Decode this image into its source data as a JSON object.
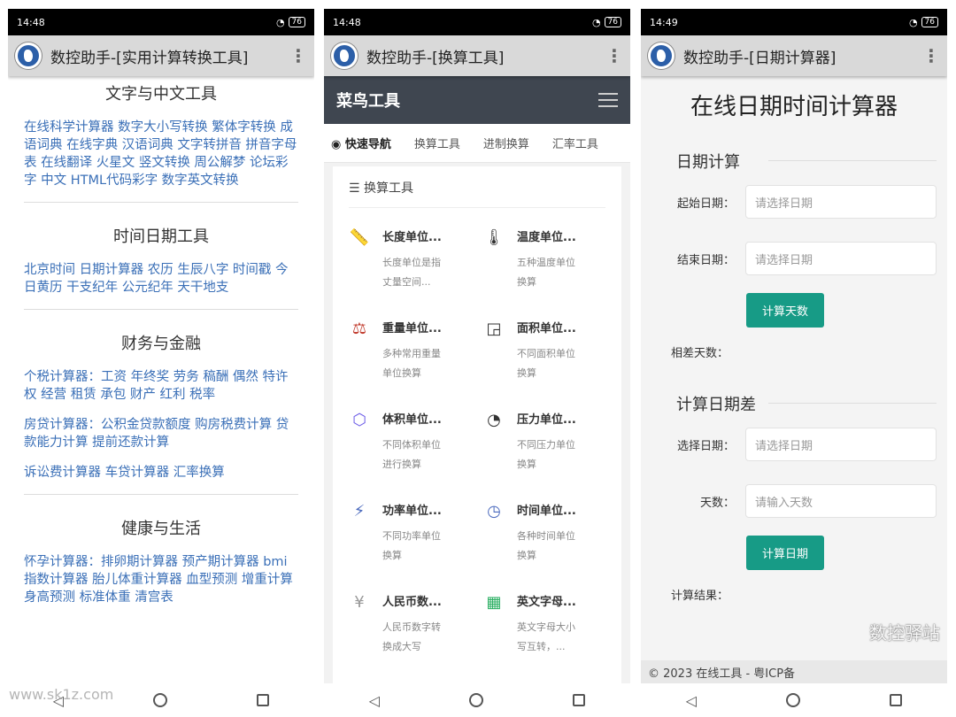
{
  "panel1": {
    "status_time": "14:48",
    "battery": "76",
    "app_title": "数控助手-[实用计算转换工具]",
    "sections": [
      {
        "title": "文字与中文工具",
        "paragraphs": [
          "在线科学计算器 数字大小写转换 繁体字转换 成语词典 在线字典 汉语词典 文字转拼音 拼音字母表 在线翻译 火星文 竖文转换 周公解梦 论坛彩字 中文 HTML代码彩字 数字英文转换"
        ]
      },
      {
        "title": "时间日期工具",
        "paragraphs": [
          "北京时间 日期计算器 农历 生辰八字 时间戳 今日黄历 干支纪年 公元纪年 天干地支"
        ]
      },
      {
        "title": "财务与金融",
        "paragraphs": [
          "个税计算器：工资 年终奖 劳务 稿酬 偶然 特许权 经营 租赁 承包 财产 红利 税率",
          "房贷计算器：公积金贷款额度 购房税费计算 贷款能力计算 提前还款计算",
          "诉讼费计算器 车贷计算器 汇率换算"
        ]
      },
      {
        "title": "健康与生活",
        "paragraphs": [
          "怀孕计算器：排卵期计算器 预产期计算器 bmi指数计算器 胎儿体重计算器 血型预测 增重计算 身高预测 标准体重 清宫表"
        ]
      }
    ]
  },
  "panel2": {
    "status_time": "14:48",
    "battery": "76",
    "app_title": "数控助手-[换算工具]",
    "brand": "菜鸟工具",
    "tabs": [
      "快速导航",
      "换算工具",
      "进制换算",
      "汇率工具"
    ],
    "card_title": "换算工具",
    "tools": [
      {
        "icon": "ruler-icon",
        "glyph": "📏",
        "name": "长度单位...",
        "desc": "长度单位是指丈量空间..."
      },
      {
        "icon": "thermometer-icon",
        "glyph": "🌡",
        "name": "温度单位...",
        "desc": "五种温度单位换算"
      },
      {
        "icon": "scale-icon",
        "glyph": "⚖",
        "name": "重量单位...",
        "desc": "多种常用重量单位换算"
      },
      {
        "icon": "area-icon",
        "glyph": "◲",
        "name": "面积单位...",
        "desc": "不同面积单位换算"
      },
      {
        "icon": "cube-icon",
        "glyph": "⬡",
        "name": "体积单位...",
        "desc": "不同体积单位进行换算"
      },
      {
        "icon": "gauge-icon",
        "glyph": "◔",
        "name": "压力单位...",
        "desc": "不同压力单位换算"
      },
      {
        "icon": "power-icon",
        "glyph": "⚡",
        "name": "功率单位...",
        "desc": "不同功率单位换算"
      },
      {
        "icon": "clock-icon",
        "glyph": "◷",
        "name": "时间单位...",
        "desc": "各种时间单位换算"
      },
      {
        "icon": "yuan-icon",
        "glyph": "¥",
        "name": "人民币数...",
        "desc": "人民币数字转换成大写"
      },
      {
        "icon": "letters-icon",
        "glyph": "▦",
        "name": "英文字母...",
        "desc": "英文字母大小写互转，..."
      }
    ]
  },
  "panel3": {
    "status_time": "14:49",
    "battery": "76",
    "app_title": "数控助手-[日期计算器]",
    "page_title": "在线日期时间计算器",
    "section1": {
      "legend": "日期计算",
      "start_label": "起始日期：",
      "start_placeholder": "请选择日期",
      "end_label": "结束日期：",
      "end_placeholder": "请选择日期",
      "button": "计算天数",
      "result_label": "相差天数："
    },
    "section2": {
      "legend": "计算日期差",
      "date_label": "选择日期：",
      "date_placeholder": "请选择日期",
      "days_label": "天数：",
      "days_placeholder": "请输入天数",
      "button": "计算日期",
      "result_label": "计算结果："
    },
    "footer": "© 2023 在线工具 - 粤ICP备",
    "watermark": "数控驿站"
  },
  "site_watermark": "www.sk1z.com",
  "colors": {
    "link": "#3a6fb7",
    "accent": "#179b86",
    "dark_bar": "#3f4650"
  }
}
